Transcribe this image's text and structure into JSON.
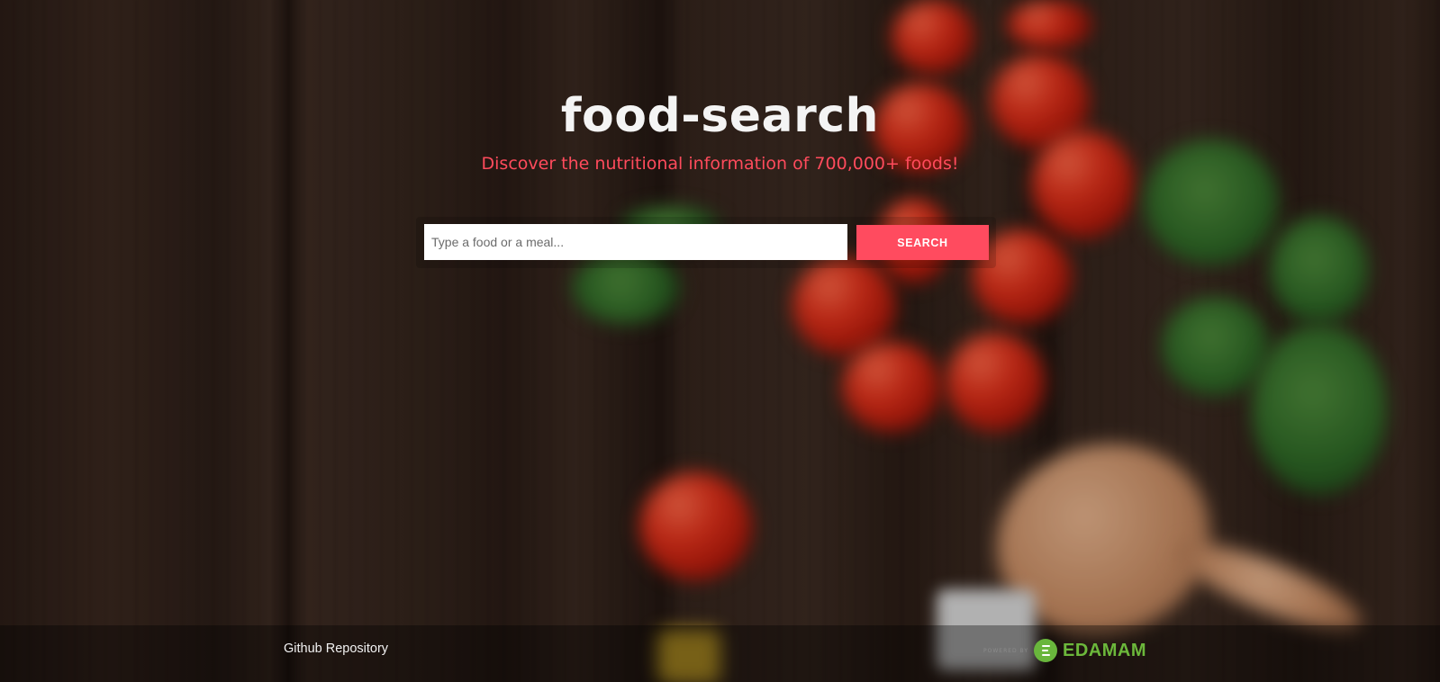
{
  "app": {
    "title": "food-search",
    "tagline": "Discover the nutritional information of 700,000+ foods!"
  },
  "search": {
    "placeholder": "Type a food or a meal...",
    "value": "",
    "button_label": "SEARCH"
  },
  "footer": {
    "repo_link_label": "Github Repository",
    "powered_by_label": "POWERED BY",
    "provider_name": "EDAMAM"
  },
  "colors": {
    "accent": "#ff4b5f",
    "title_text": "#f4f4f4",
    "provider_green": "#6cb83b"
  },
  "icons": {
    "provider_logo": "edamam-logo-icon"
  }
}
